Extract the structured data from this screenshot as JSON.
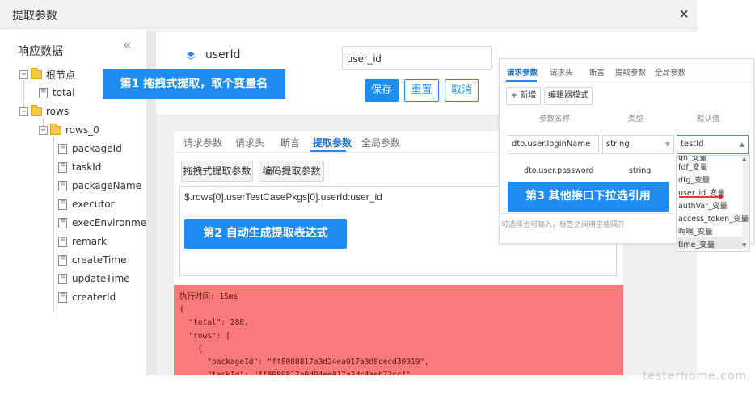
{
  "dialog": {
    "title": "提取参数",
    "close_icon": "×"
  },
  "left_panel": {
    "title": "响应数据",
    "collapse_icon": "«",
    "tree": {
      "root": "根节点",
      "total": "total",
      "rows": "rows",
      "rows_0": "rows_0",
      "fields": [
        "packageId",
        "taskId",
        "packageName",
        "executor",
        "execEnvironment",
        "remark",
        "createTime",
        "updateTime",
        "createrId"
      ]
    }
  },
  "header": {
    "field_name": "userId",
    "variable_input": "user_id",
    "save": "保存",
    "reset": "重置",
    "cancel": "取消"
  },
  "tabs": [
    "请求参数",
    "请求头",
    "断言",
    "提取参数",
    "全局参数"
  ],
  "active_tab": "提取参数",
  "extract": {
    "drag_button": "拖拽式提取参数",
    "code_button": "编码提取参数",
    "expression": "$.rows[0].userTestCasePkgs[0].userId:user_id"
  },
  "code_output": "执行时间: 15ms\n{\n  \"total\": 288,\n  \"rows\": [\n    {\n      \"packageId\": \"ff8080817a3d24ea017a3d8cecd30019\",\n      \"taskId\": \"ff8080817a0d94ee017a2dc4aeb73ccf\",\n      \"packageName\": \"最新数据\",",
  "annotations": {
    "step1": "第1 拖拽式提取，取个变量名",
    "step2": "第2  自动生成提取表达式",
    "step3": "第3  其他接口下拉选引用"
  },
  "popup": {
    "tabs": [
      "请求参数",
      "请求头",
      "断言",
      "提取参数",
      "全局参数"
    ],
    "add_button": "+ 新增",
    "editor_button": "编辑器模式",
    "columns": [
      "参数名称",
      "类型",
      "默认值"
    ],
    "row1": {
      "name": "dto.user.loginName",
      "type": "string",
      "default": "testId"
    },
    "row2": {
      "name": "dto.user.password",
      "type": "string"
    },
    "hint": "可选择也可输入，标签之间用空格隔开",
    "dropdown_items": [
      "gh_变量",
      "fdf_变量",
      "dfg_变量",
      "user_id_变量",
      "authVar_变量",
      "access_token_变量",
      "啊啊_变量",
      "time_变量"
    ]
  },
  "watermark": "testerhome.com",
  "colors": {
    "accent": "#1e8cf0",
    "code_bg": "#f87a7a"
  }
}
